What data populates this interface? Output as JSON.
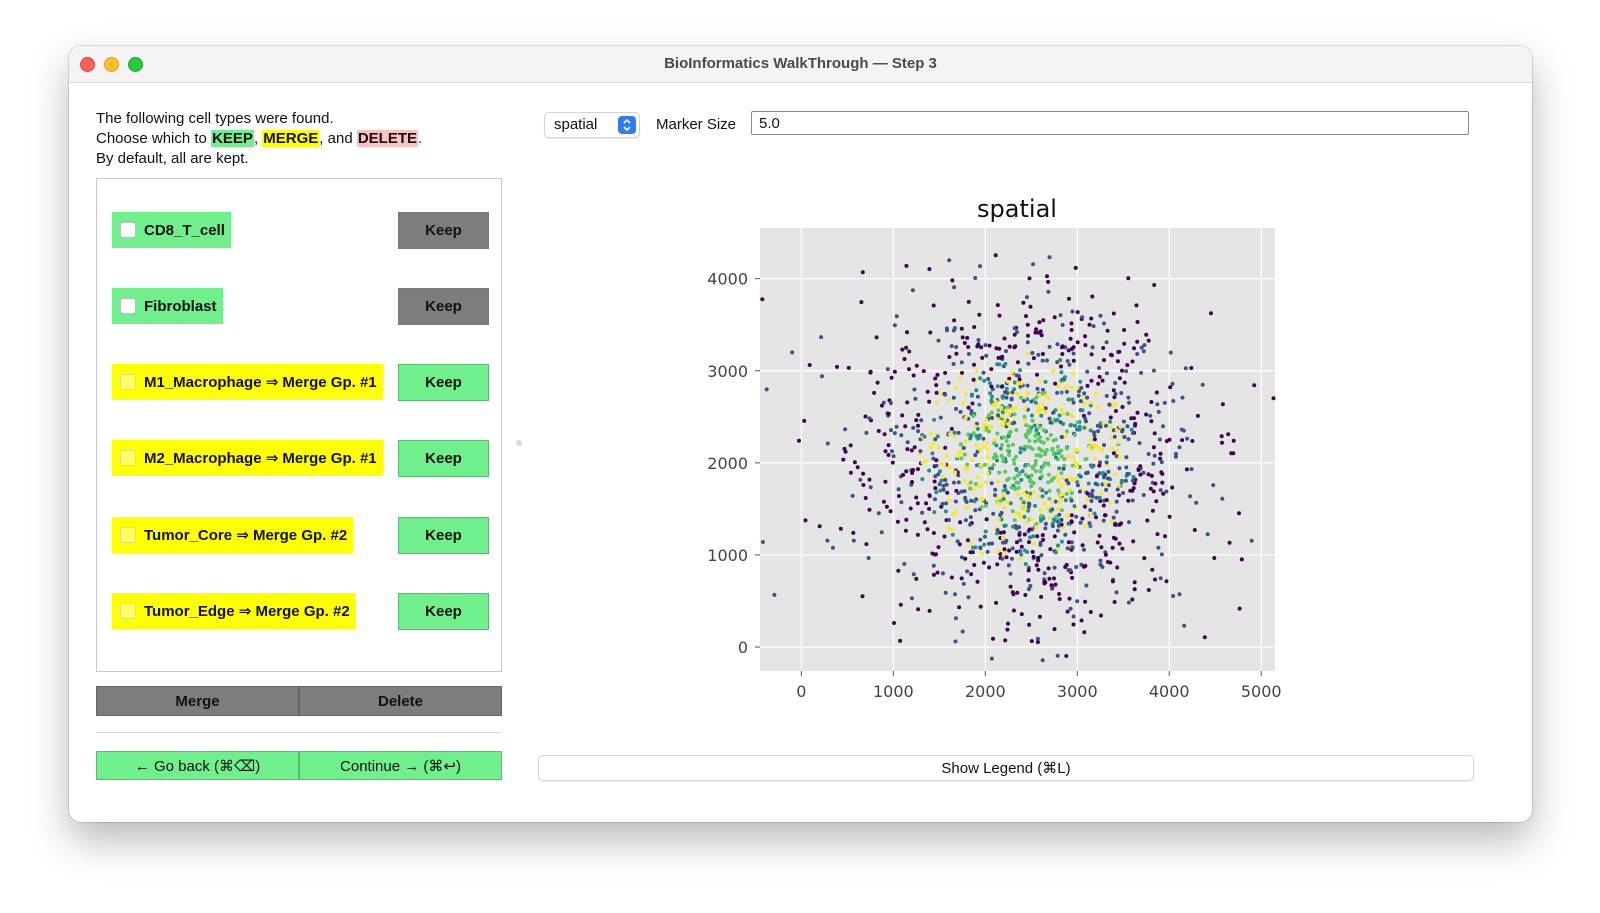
{
  "window": {
    "title": "BioInformatics WalkThrough — Step 3"
  },
  "instructions": {
    "line1": "The following cell types were found.",
    "line2_prefix": "Choose which to ",
    "keep_word": "KEEP",
    "comma1": ", ",
    "merge_word": "MERGE",
    "and_text": ", and ",
    "delete_word": "DELETE",
    "period": ".",
    "line3": "By default, all are kept."
  },
  "cell_types": [
    {
      "label": "CD8_T_cell",
      "highlight": "#6ff08c",
      "button": "Keep",
      "button_color": "#7d7d7d"
    },
    {
      "label": "Fibroblast",
      "highlight": "#6ff08c",
      "button": "Keep",
      "button_color": "#7d7d7d"
    },
    {
      "label": "M1_Macrophage ⇒ Merge Gp. #1",
      "highlight": "#ffff00",
      "button": "Keep",
      "button_color": "#6ff08c"
    },
    {
      "label": "M2_Macrophage ⇒ Merge Gp. #1",
      "highlight": "#ffff00",
      "button": "Keep",
      "button_color": "#6ff08c"
    },
    {
      "label": "Tumor_Core ⇒ Merge Gp. #2",
      "highlight": "#ffff00",
      "button": "Keep",
      "button_color": "#6ff08c"
    },
    {
      "label": "Tumor_Edge ⇒ Merge Gp. #2",
      "highlight": "#ffff00",
      "button": "Keep",
      "button_color": "#6ff08c"
    }
  ],
  "actions": {
    "merge": "Merge",
    "delete": "Delete"
  },
  "nav": {
    "back": "← Go back (⌘⌫)",
    "continue": "Continue → (⌘↩)"
  },
  "controls": {
    "embedding_select": "spatial",
    "marker_size_label": "Marker Size",
    "marker_size_value": "5.0",
    "show_legend": "Show Legend (⌘L)"
  },
  "chart_data": {
    "type": "scatter",
    "title": "spatial",
    "xlabel": "",
    "ylabel": "",
    "xlim": [
      -450,
      5150
    ],
    "ylim": [
      -260,
      4550
    ],
    "x_ticks": [
      0,
      1000,
      2000,
      3000,
      4000,
      5000
    ],
    "y_ticks": [
      0,
      1000,
      2000,
      3000,
      4000
    ],
    "grid": true,
    "background": "#e5e5e5",
    "colormap": [
      "#440154",
      "#3b528b",
      "#21908c",
      "#5dc863",
      "#fde725"
    ],
    "point_count": 1500,
    "center": [
      2450,
      2050
    ],
    "spread": [
      850,
      820
    ],
    "series_colors_note_free": true
  }
}
